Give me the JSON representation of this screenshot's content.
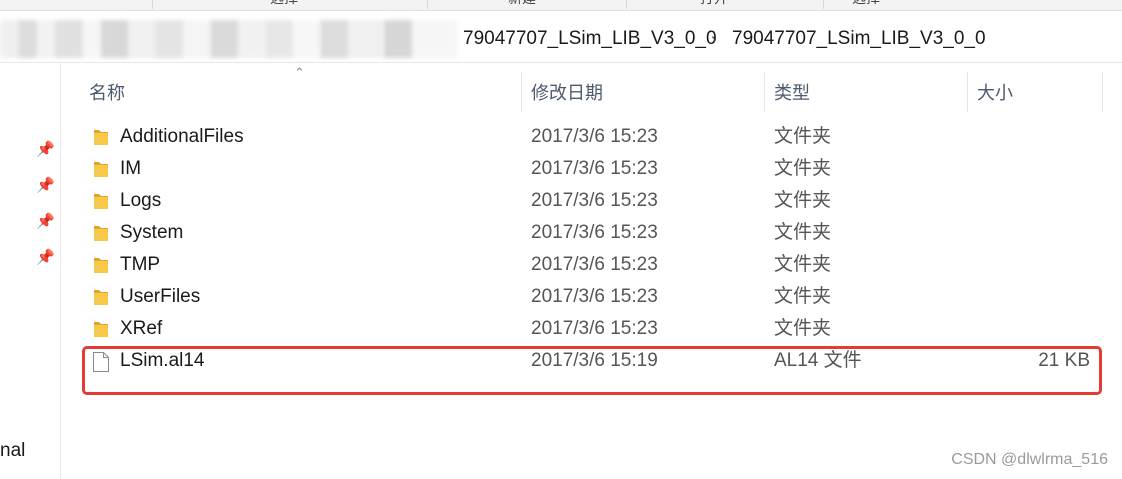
{
  "ribbon": {
    "cut_labels": [
      "选择",
      "新建",
      "打开",
      "选择"
    ]
  },
  "address": {
    "crumbs": [
      "79047707_LSim_LIB_V3_0_0",
      "79047707_LSim_LIB_V3_0_0"
    ],
    "separator": "›"
  },
  "nav": {
    "pins": [
      "pin-icon",
      "pin-icon",
      "pin-icon",
      "pin-icon"
    ],
    "partial_label": "nal"
  },
  "columns": {
    "name": "名称",
    "date": "修改日期",
    "type": "类型",
    "size": "大小"
  },
  "files": [
    {
      "name": "AdditionalFiles",
      "date": "2017/3/6 15:23",
      "type": "文件夹",
      "size": "",
      "icon": "folder-icon"
    },
    {
      "name": "IM",
      "date": "2017/3/6 15:23",
      "type": "文件夹",
      "size": "",
      "icon": "folder-icon"
    },
    {
      "name": "Logs",
      "date": "2017/3/6 15:23",
      "type": "文件夹",
      "size": "",
      "icon": "folder-icon"
    },
    {
      "name": "System",
      "date": "2017/3/6 15:23",
      "type": "文件夹",
      "size": "",
      "icon": "folder-icon"
    },
    {
      "name": "TMP",
      "date": "2017/3/6 15:23",
      "type": "文件夹",
      "size": "",
      "icon": "folder-icon"
    },
    {
      "name": "UserFiles",
      "date": "2017/3/6 15:23",
      "type": "文件夹",
      "size": "",
      "icon": "folder-icon"
    },
    {
      "name": "XRef",
      "date": "2017/3/6 15:23",
      "type": "文件夹",
      "size": "",
      "icon": "folder-icon"
    },
    {
      "name": "LSim.al14",
      "date": "2017/3/6 15:19",
      "type": "AL14 文件",
      "size": "21 KB",
      "icon": "file-icon"
    }
  ],
  "colors": {
    "folder": "#f7c948",
    "folder_dark": "#e0a526",
    "highlight": "#e53935",
    "header_text": "#4c5a6e"
  },
  "watermark": "CSDN @dlwlrma_516"
}
